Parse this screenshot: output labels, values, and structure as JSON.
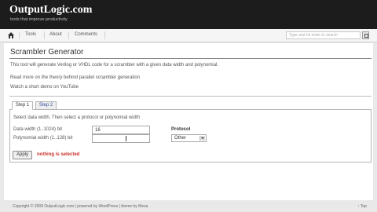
{
  "header": {
    "site_title": "OutputLogic.com",
    "tagline": "tools that improve productivity"
  },
  "nav": {
    "items": [
      {
        "label": "Tools"
      },
      {
        "label": "About"
      },
      {
        "label": "Comments"
      }
    ],
    "search_placeholder": "Type and hit enter to search"
  },
  "main": {
    "title": "Scrambler Generator",
    "description": "This tool will generate Verilog or VHDL code for a scrambler with a given data width and polynomial.",
    "theory_link": "Read more on the theory behind parallel scrambler generation",
    "demo_link": "Watch a short demo on YouTube",
    "tabs": [
      {
        "label": "Step 1",
        "active": true
      },
      {
        "label": "Step 2",
        "active": false
      }
    ],
    "form": {
      "instruction": "Select data width. Then select a protocol or polynomial width",
      "data_width_label": "Data width (1..1024) bit",
      "data_width_value": "16",
      "poly_width_label": "Polynomial width (1..128) bit",
      "poly_width_value": "",
      "protocol_label": "Protocol",
      "protocol_selected": "Other",
      "apply_label": "Apply",
      "status": "nothing is selected"
    }
  },
  "footer": {
    "copyright": "Copyright © 2009 OutputLogic.com | powered by WordPress | theme by Mesa",
    "top_link": "↑ Top"
  },
  "colors": {
    "header_bg": "#1c1c1c",
    "status_red": "#c8322a",
    "link_blue": "#2f4f9f"
  }
}
